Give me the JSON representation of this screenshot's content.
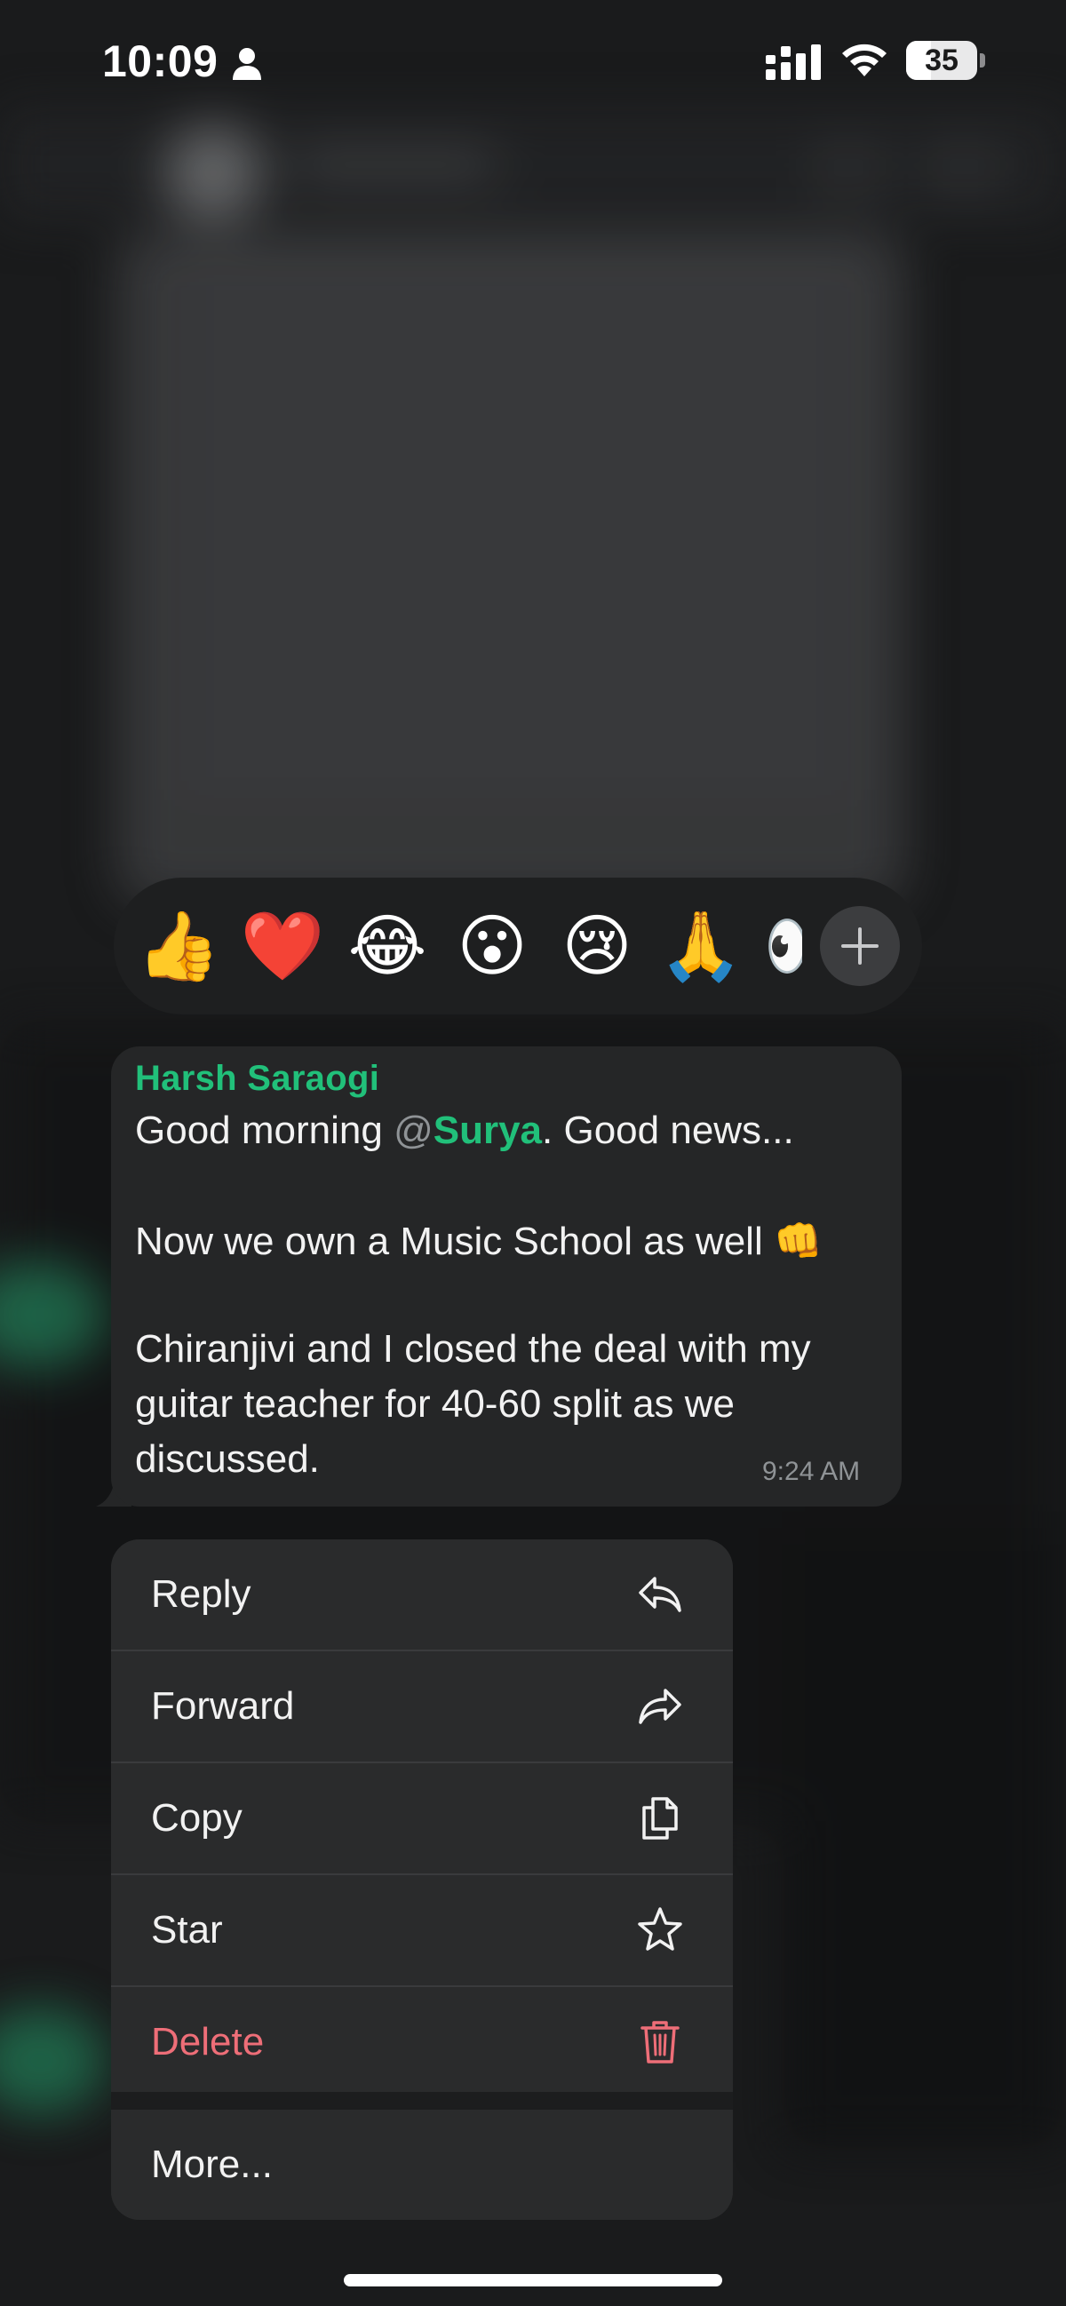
{
  "status_bar": {
    "time": "10:09",
    "battery": "35",
    "battery_level": 0.35,
    "icons": [
      "person-icon",
      "signal-icon",
      "wifi-icon",
      "battery-icon"
    ]
  },
  "reactions": {
    "items": [
      "👍",
      "❤️",
      "😂",
      "😮",
      "😢",
      "🙏",
      "👀"
    ],
    "add_icon": "plus-icon"
  },
  "message": {
    "sender": "Harsh Saraogi",
    "sender_color": "#21c07a",
    "line1_prefix": "Good morning ",
    "mention_at": "@",
    "mention_name": "Surya",
    "line1_suffix": ". Good news...",
    "line2": "Now we own a Music School as well 👊",
    "line3": "Chiranjivi and I closed the deal with my",
    "line4": "guitar teacher for 40-60 split as we",
    "line5": "discussed.",
    "time": "9:24 AM"
  },
  "menu": {
    "reply": "Reply",
    "forward": "Forward",
    "copy": "Copy",
    "star": "Star",
    "delete": "Delete",
    "more": "More...",
    "delete_color": "#ee6e78",
    "icons": [
      "reply-icon",
      "forward-icon",
      "copy-icon",
      "star-icon",
      "trash-icon"
    ]
  }
}
